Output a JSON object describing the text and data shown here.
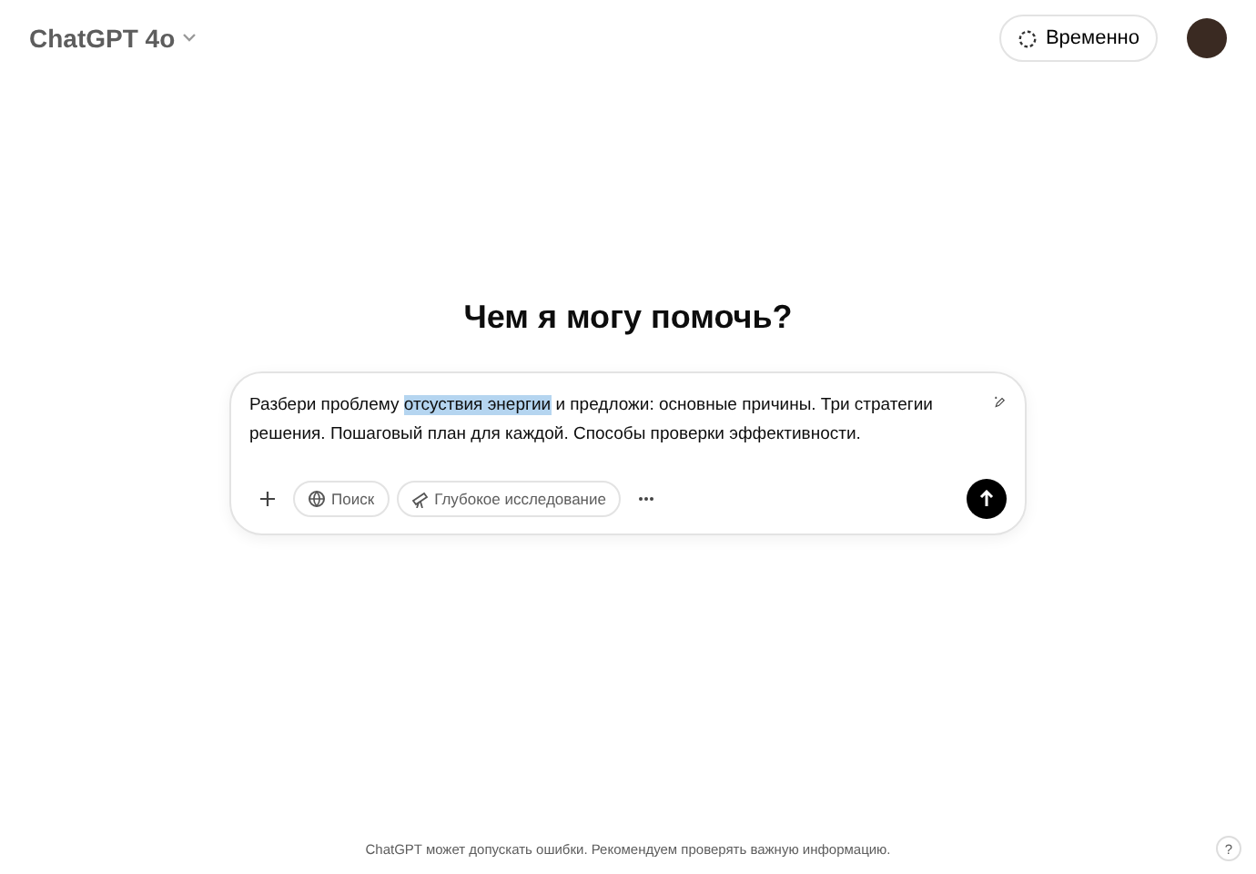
{
  "header": {
    "model": "ChatGPT 4o",
    "temporary_button": "Временно"
  },
  "heading": "Чем я могу помочь?",
  "composer": {
    "prompt": [
      {
        "text": "Разбери проблему ",
        "selected": false
      },
      {
        "text": "отсуствия энергии",
        "selected": true
      },
      {
        "text": " и предложи: основные причины. Три стратегии решения. Пошаговый план для каждой. Способы проверки эффективности.",
        "selected": false
      }
    ],
    "tools": [
      {
        "kind": "plus"
      },
      {
        "kind": "search",
        "label": "Поиск"
      },
      {
        "kind": "research",
        "label": "Глубокое исследование"
      },
      {
        "kind": "more"
      }
    ]
  },
  "disclaimer": "ChatGPT может допускать ошибки. Рекомендуем проверять важную информацию.",
  "help": "?"
}
